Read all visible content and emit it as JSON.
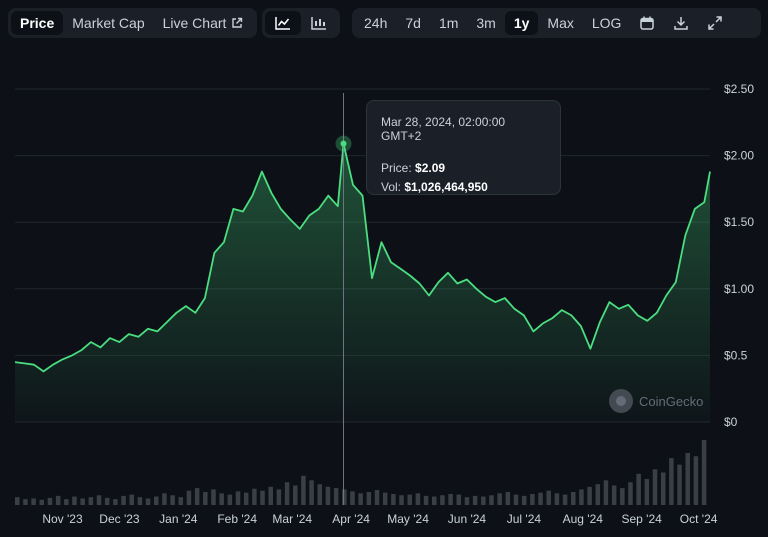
{
  "toolbar": {
    "view_tabs": [
      {
        "label": "Price",
        "active": true
      },
      {
        "label": "Market Cap",
        "active": false
      },
      {
        "label": "Live Chart",
        "active": false
      }
    ],
    "chart_type_buttons": [
      {
        "icon": "line-chart-icon",
        "active": true
      },
      {
        "icon": "candlestick-chart-icon",
        "active": false
      }
    ],
    "ranges": [
      {
        "label": "24h",
        "active": false
      },
      {
        "label": "7d",
        "active": false
      },
      {
        "label": "1m",
        "active": false
      },
      {
        "label": "3m",
        "active": false
      },
      {
        "label": "1y",
        "active": true
      },
      {
        "label": "Max",
        "active": false
      },
      {
        "label": "LOG",
        "active": false
      }
    ],
    "tools": [
      "calendar-icon",
      "download-icon",
      "expand-icon"
    ]
  },
  "tooltip": {
    "date": "Mar 28, 2024, 02:00:00 GMT+2",
    "price_label": "Price:",
    "price_value": "$2.09",
    "vol_label": "Vol:",
    "vol_value": "$1,026,464,950"
  },
  "watermark": "CoinGecko",
  "colors": {
    "background": "#0d1117",
    "line": "#4ade80",
    "volume": "#3a3f47",
    "toolbar_bg": "#1b2028"
  },
  "chart_data": {
    "type": "area",
    "y_ticks": [
      "$2.50",
      "$2.00",
      "$1.50",
      "$1.00",
      "$0.5",
      "$0"
    ],
    "ylim": [
      0,
      2.5
    ],
    "x_ticks": [
      "Nov '23",
      "Dec '23",
      "Jan '24",
      "Feb '24",
      "Mar '24",
      "Apr '24",
      "May '24",
      "Jun '24",
      "Jul '24",
      "Aug '24",
      "Sep '24",
      "Oct '24"
    ],
    "highlight": {
      "date": "Mar 28, 2024",
      "value": 2.09
    },
    "points": [
      [
        "2023-10-07",
        0.45
      ],
      [
        "2023-10-12",
        0.44
      ],
      [
        "2023-10-17",
        0.43
      ],
      [
        "2023-10-22",
        0.38
      ],
      [
        "2023-10-27",
        0.43
      ],
      [
        "2023-11-01",
        0.47
      ],
      [
        "2023-11-06",
        0.5
      ],
      [
        "2023-11-11",
        0.54
      ],
      [
        "2023-11-16",
        0.6
      ],
      [
        "2023-11-21",
        0.56
      ],
      [
        "2023-11-26",
        0.63
      ],
      [
        "2023-12-01",
        0.6
      ],
      [
        "2023-12-06",
        0.66
      ],
      [
        "2023-12-11",
        0.64
      ],
      [
        "2023-12-16",
        0.7
      ],
      [
        "2023-12-21",
        0.68
      ],
      [
        "2023-12-26",
        0.75
      ],
      [
        "2023-12-31",
        0.82
      ],
      [
        "2024-01-05",
        0.87
      ],
      [
        "2024-01-10",
        0.82
      ],
      [
        "2024-01-15",
        0.93
      ],
      [
        "2024-01-20",
        1.27
      ],
      [
        "2024-01-25",
        1.35
      ],
      [
        "2024-01-30",
        1.6
      ],
      [
        "2024-02-04",
        1.58
      ],
      [
        "2024-02-09",
        1.7
      ],
      [
        "2024-02-14",
        1.88
      ],
      [
        "2024-02-19",
        1.72
      ],
      [
        "2024-02-24",
        1.6
      ],
      [
        "2024-02-29",
        1.52
      ],
      [
        "2024-03-05",
        1.45
      ],
      [
        "2024-03-10",
        1.55
      ],
      [
        "2024-03-15",
        1.6
      ],
      [
        "2024-03-20",
        1.7
      ],
      [
        "2024-03-25",
        1.62
      ],
      [
        "2024-03-28",
        2.09
      ],
      [
        "2024-04-02",
        1.78
      ],
      [
        "2024-04-07",
        1.7
      ],
      [
        "2024-04-12",
        1.08
      ],
      [
        "2024-04-17",
        1.35
      ],
      [
        "2024-04-22",
        1.2
      ],
      [
        "2024-04-27",
        1.15
      ],
      [
        "2024-05-02",
        1.1
      ],
      [
        "2024-05-07",
        1.04
      ],
      [
        "2024-05-12",
        0.95
      ],
      [
        "2024-05-17",
        1.05
      ],
      [
        "2024-05-22",
        1.12
      ],
      [
        "2024-05-27",
        1.04
      ],
      [
        "2024-06-01",
        1.07
      ],
      [
        "2024-06-06",
        1.0
      ],
      [
        "2024-06-11",
        0.94
      ],
      [
        "2024-06-16",
        0.9
      ],
      [
        "2024-06-21",
        0.93
      ],
      [
        "2024-06-26",
        0.85
      ],
      [
        "2024-07-01",
        0.8
      ],
      [
        "2024-07-06",
        0.68
      ],
      [
        "2024-07-11",
        0.74
      ],
      [
        "2024-07-16",
        0.78
      ],
      [
        "2024-07-21",
        0.84
      ],
      [
        "2024-07-26",
        0.8
      ],
      [
        "2024-07-31",
        0.72
      ],
      [
        "2024-08-05",
        0.55
      ],
      [
        "2024-08-10",
        0.75
      ],
      [
        "2024-08-15",
        0.9
      ],
      [
        "2024-08-20",
        0.85
      ],
      [
        "2024-08-25",
        0.88
      ],
      [
        "2024-08-30",
        0.8
      ],
      [
        "2024-09-04",
        0.76
      ],
      [
        "2024-09-09",
        0.82
      ],
      [
        "2024-09-14",
        0.95
      ],
      [
        "2024-09-19",
        1.05
      ],
      [
        "2024-09-24",
        1.4
      ],
      [
        "2024-09-29",
        1.6
      ],
      [
        "2024-10-04",
        1.65
      ],
      [
        "2024-10-07",
        1.88
      ]
    ],
    "volume": [
      12,
      9,
      10,
      8,
      11,
      14,
      9,
      13,
      10,
      12,
      15,
      11,
      9,
      14,
      16,
      12,
      10,
      13,
      18,
      15,
      12,
      22,
      26,
      20,
      24,
      18,
      16,
      21,
      19,
      25,
      22,
      28,
      24,
      35,
      30,
      45,
      38,
      32,
      28,
      26,
      24,
      21,
      18,
      20,
      23,
      19,
      17,
      15,
      16,
      18,
      14,
      13,
      15,
      17,
      16,
      12,
      14,
      13,
      15,
      18,
      20,
      16,
      14,
      17,
      19,
      22,
      18,
      16,
      20,
      24,
      28,
      32,
      38,
      30,
      26,
      35,
      48,
      40,
      55,
      50,
      72,
      62,
      80,
      75,
      100
    ]
  }
}
